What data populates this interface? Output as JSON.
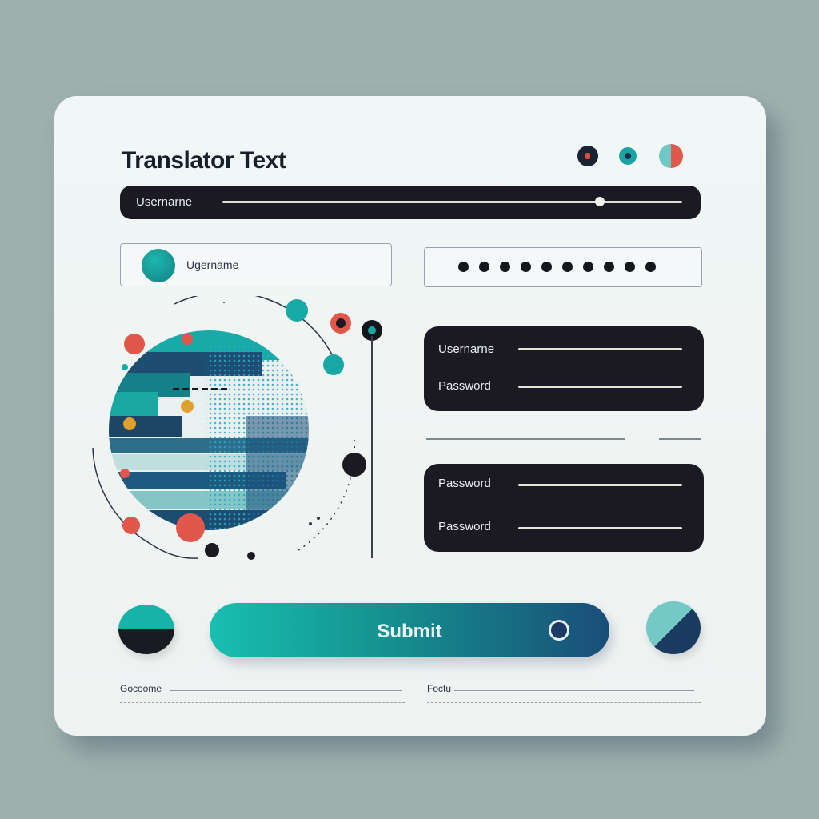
{
  "header": {
    "title": "Translator Text",
    "window_controls": [
      "record-icon",
      "dot-icon",
      "split-circle-icon"
    ]
  },
  "top_bar": {
    "label": "Usernarne"
  },
  "username_field": {
    "label": "Ugername"
  },
  "password_field": {
    "masked_length": 10
  },
  "panel_one": {
    "rows": [
      {
        "label": "Usernarne"
      },
      {
        "label": "Password"
      }
    ]
  },
  "panel_two": {
    "rows": [
      {
        "label": "Password"
      },
      {
        "label": "Password"
      }
    ]
  },
  "actions": {
    "submit_label": "Submit"
  },
  "footer": {
    "left_label": "Gocoome",
    "right_label": "Foctu"
  },
  "colors": {
    "background": "#9fb1ae",
    "card": "#eef3f2",
    "dark_panel": "#1b1a22",
    "teal": "#18b3aa",
    "navy": "#1a3b5f",
    "coral": "#e2574c",
    "amber": "#e0a030"
  }
}
